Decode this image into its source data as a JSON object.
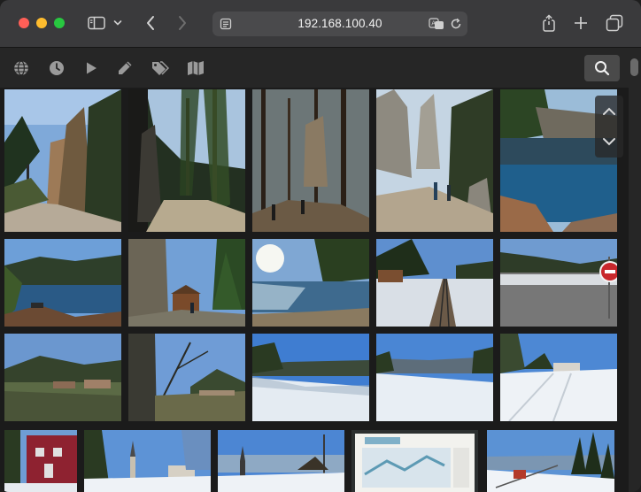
{
  "browser": {
    "url": "192.168.100.40",
    "toolbar_icons": [
      "sidebar-icon",
      "chevron-down-icon",
      "back-icon",
      "forward-icon",
      "reader-icon",
      "translate-icon",
      "reload-icon",
      "share-icon",
      "new-tab-icon",
      "tab-overview-icon"
    ]
  },
  "appbar": {
    "icons": [
      "globe-icon",
      "clock-icon",
      "play-icon",
      "pencil-icon",
      "tags-icon",
      "map-icon",
      "search-icon"
    ]
  },
  "gallery": {
    "photos": [
      {
        "scene": "sandstone rocks and forest trail",
        "row": 1
      },
      {
        "scene": "dark forest path with rock pillars",
        "row": 1
      },
      {
        "scene": "hiker among tall pines",
        "row": 1
      },
      {
        "scene": "rock towers with hikers on path",
        "row": 1
      },
      {
        "scene": "blue lake below sandstone cliffs",
        "row": 1
      },
      {
        "scene": "lake panorama with forested ridge",
        "row": 2
      },
      {
        "scene": "rock cliff with wooden hut",
        "row": 2
      },
      {
        "scene": "sun over lake shore",
        "row": 2
      },
      {
        "scene": "railway track in frosty field",
        "row": 2
      },
      {
        "scene": "wet road with stop sign",
        "row": 2
      },
      {
        "scene": "park meadow with buildings",
        "row": 3
      },
      {
        "scene": "bare tree and village green",
        "row": 3
      },
      {
        "scene": "snowy slope with valley view",
        "row": 3
      },
      {
        "scene": "snowy field and distant hills",
        "row": 3
      },
      {
        "scene": "snowy road with houses",
        "row": 3
      },
      {
        "scene": "red wooden house",
        "row": 4
      },
      {
        "scene": "church in snowy village",
        "row": 4
      },
      {
        "scene": "village with church steeple",
        "row": 4
      },
      {
        "scene": "trail map board",
        "row": 4
      },
      {
        "scene": "ski slope with lift",
        "row": 4
      }
    ]
  },
  "colors": {
    "chrome": "#3a3a3c",
    "appbar": "#262626",
    "background": "#1b1b1b",
    "sky": "#4a86d4"
  }
}
